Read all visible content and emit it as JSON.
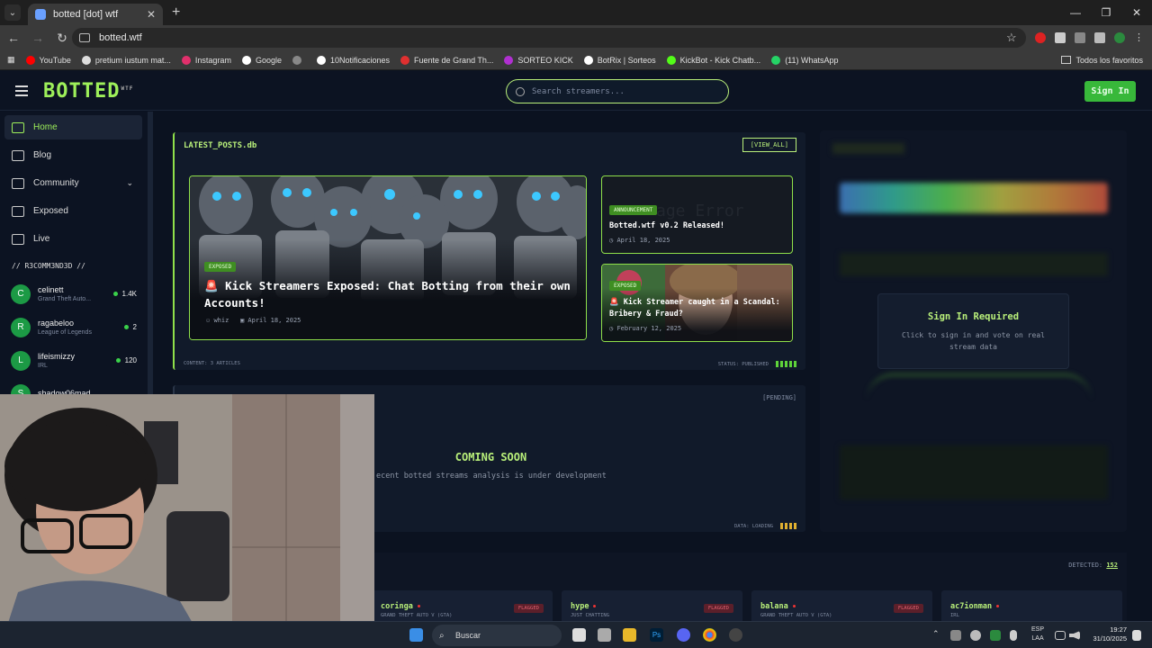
{
  "browser": {
    "tab_title": "botted [dot] wtf",
    "url": "botted.wtf",
    "bookmarks": [
      {
        "label": "YouTube",
        "color": "#ff0000"
      },
      {
        "label": "pretium iustum mat...",
        "color": "#dddddd"
      },
      {
        "label": "Instagram",
        "color": "#e1306c"
      },
      {
        "label": "Google",
        "color": "#ffffff"
      },
      {
        "label": "",
        "color": "#888888"
      },
      {
        "label": "10Notificaciones",
        "color": "#ffffff"
      },
      {
        "label": "Fuente de Grand Th...",
        "color": "#e03030"
      },
      {
        "label": "SORTEO KICK",
        "color": "#b030d0"
      },
      {
        "label": "BotRix | Sorteos",
        "color": "#ffffff"
      },
      {
        "label": "KickBot - Kick Chatb...",
        "color": "#53fc18"
      },
      {
        "label": "(11) WhatsApp",
        "color": "#25d366"
      }
    ],
    "all_bookmarks": "Todos los favoritos"
  },
  "site": {
    "logo": "BOTTED",
    "logo_sup": "WTF",
    "search_placeholder": "Search streamers...",
    "signin": "Sign In",
    "nav": [
      {
        "label": "Home",
        "active": true
      },
      {
        "label": "Blog"
      },
      {
        "label": "Community",
        "chevron": true
      },
      {
        "label": "Exposed"
      },
      {
        "label": "Live"
      }
    ],
    "recommended_title": "// R3COMM3ND3D //",
    "recommended": [
      {
        "initial": "C",
        "name": "celinett",
        "game": "Grand Theft Auto...",
        "count": "1.4K"
      },
      {
        "initial": "R",
        "name": "ragabeloo",
        "game": "League of Legends",
        "count": "2"
      },
      {
        "initial": "L",
        "name": "lifeismizzy",
        "game": "IRL",
        "count": "120"
      },
      {
        "initial": "S",
        "name": "shadow06mad",
        "game": "",
        "count": ""
      }
    ],
    "latest": {
      "title": "LATEST_POSTS.db",
      "view_all": "[VIEW_ALL]",
      "big_post": {
        "badge": "EXPOSED",
        "title": "🚨 Kick Streamers Exposed: Chat Botting from their own Accounts!",
        "author": "whiz",
        "date": "April 18, 2025"
      },
      "post2": {
        "badge": "ANNOUNCEMENT",
        "title": "Botted.wtf v0.2 Released!",
        "date": "April 18, 2025",
        "ghost": "age Error"
      },
      "post3": {
        "badge": "EXPOSED",
        "title": "🚨 Kick Streamer caught in a Scandal: Bribery & Fraud?",
        "date": "February 12, 2025"
      },
      "footer_left": "CONTENT: 3 ARTICLES",
      "footer_status": "STATUS: PUBLISHED"
    },
    "coming": {
      "pending": "[PENDING]",
      "title": "COMING SOON",
      "subtitle": "ecent botted streams analysis is under development",
      "data_status": "DATA: LOADING"
    },
    "signin_required": {
      "title": "Sign In Required",
      "subtitle": "Click to sign in and vote on real stream data"
    },
    "detected": {
      "label": "DETECTED:",
      "count": "152",
      "cards": [
        {
          "name": "",
          "game": "",
          "flag": "FLAGGED"
        },
        {
          "name": "coringa",
          "game": "GRAND THEFT AUTO V (GTA)",
          "flag": "FLAGGED"
        },
        {
          "name": "hype",
          "game": "JUST CHATTING",
          "flag": "FLAGGED"
        },
        {
          "name": "balana",
          "game": "GRAND THEFT AUTO V (GTA)",
          "flag": "FLAGGED"
        },
        {
          "name": "ac7ionman",
          "game": "IRL",
          "flag": ""
        }
      ]
    }
  },
  "taskbar": {
    "search": "Buscar",
    "lang1": "ESP",
    "lang2": "LAA",
    "time": "19:27",
    "date": "31/10/2025"
  }
}
